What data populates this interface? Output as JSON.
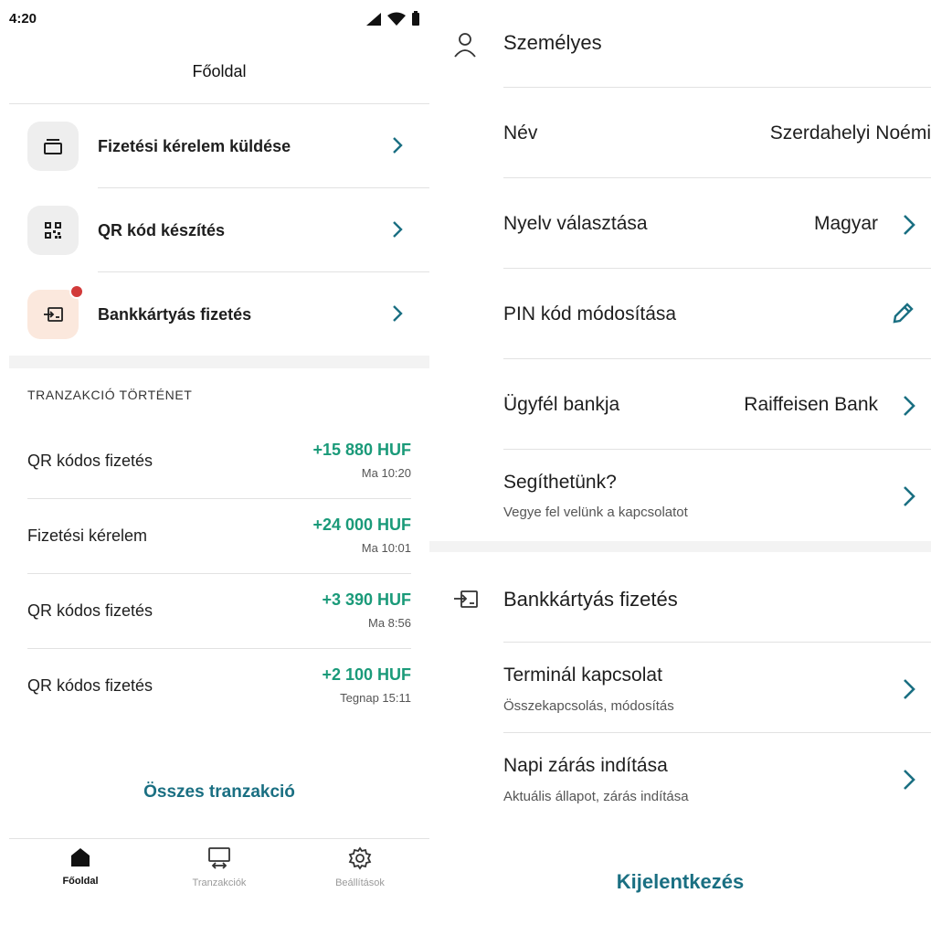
{
  "left": {
    "status_time": "4:20",
    "page_title": "Főoldal",
    "actions": [
      {
        "label": "Fizetési kérelem küldése",
        "icon": "card-outline-icon"
      },
      {
        "label": "QR kód készítés",
        "icon": "qr-code-icon"
      },
      {
        "label": "Bankkártyás fizetés",
        "icon": "card-terminal-icon",
        "badge": true
      }
    ],
    "history_title": "TRANZAKCIÓ TÖRTÉNET",
    "transactions": [
      {
        "name": "QR kódos fizetés",
        "amount": "+15 880 HUF",
        "time": "Ma 10:20"
      },
      {
        "name": "Fizetési kérelem",
        "amount": "+24 000 HUF",
        "time": "Ma 10:01"
      },
      {
        "name": "QR kódos fizetés",
        "amount": "+3 390 HUF",
        "time": "Ma 8:56"
      },
      {
        "name": "QR kódos fizetés",
        "amount": "+2 100 HUF",
        "time": "Tegnap 15:11"
      }
    ],
    "all_transactions_label": "Összes tranzakció",
    "nav": [
      {
        "label": "Főoldal",
        "icon": "home-icon",
        "active": true
      },
      {
        "label": "Tranzakciók",
        "icon": "transactions-icon",
        "active": false
      },
      {
        "label": "Beállítások",
        "icon": "gear-icon",
        "active": false
      }
    ]
  },
  "right": {
    "personal_title": "Személyes",
    "name_label": "Név",
    "name_value": "Szerdahelyi Noémi",
    "language_label": "Nyelv választása",
    "language_value": "Magyar",
    "pin_label": "PIN kód módosítása",
    "bank_label": "Ügyfél bankja",
    "bank_value": "Raiffeisen Bank",
    "help_label": "Segíthetünk?",
    "help_sub": "Vegye fel velünk a kapcsolatot",
    "card_title": "Bankkártyás fizetés",
    "terminal_label": "Terminál kapcsolat",
    "terminal_sub": "Összekapcsolás, módosítás",
    "daily_label": "Napi zárás indítása",
    "daily_sub": "Aktuális állapot, zárás indítása",
    "logout_label": "Kijelentkezés"
  },
  "colors": {
    "accent": "#1a6f82",
    "amount_green": "#1a9a79",
    "badge_red": "#d23a3a",
    "orange_tile": "#fbe8dd"
  }
}
